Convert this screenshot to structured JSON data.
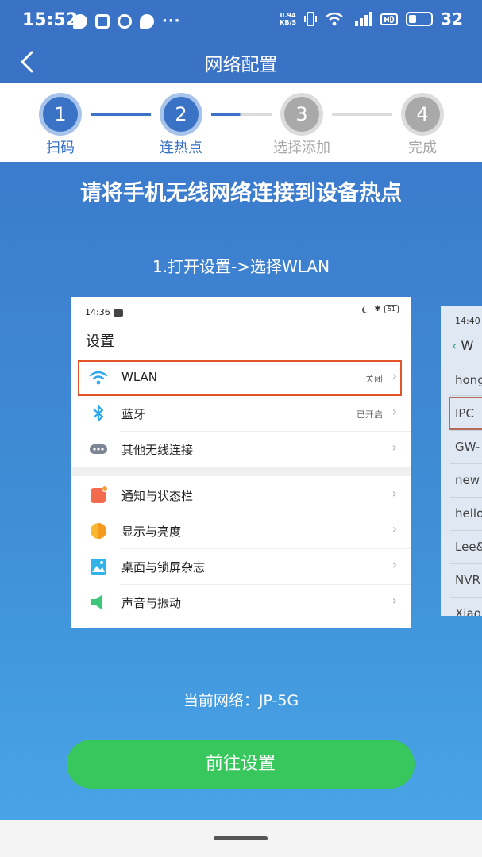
{
  "status_bar": {
    "time": "15:52",
    "net_speed_value": "0.94",
    "net_speed_unit": "KB/S",
    "battery": "32"
  },
  "header": {
    "title": "网络配置"
  },
  "steps": [
    {
      "number": "1",
      "label": "扫码",
      "state": "done"
    },
    {
      "number": "2",
      "label": "连热点",
      "state": "current"
    },
    {
      "number": "3",
      "label": "选择添加",
      "state": "pending"
    },
    {
      "number": "4",
      "label": "完成",
      "state": "pending"
    }
  ],
  "colors": {
    "primary": "#3a73c6",
    "button": "#38c75c",
    "highlight": "#e2552a",
    "inactive": "#a9a9a9"
  },
  "main": {
    "headline": "请将手机无线网络连接到设备热点",
    "instruction": "1.打开设置->选择WLAN",
    "current_network_label": "当前网络：",
    "current_network": "JP-5G",
    "go_settings_button": "前往设置"
  },
  "example_settings": {
    "time": "14:36",
    "battery": "51",
    "title": "设置",
    "items": [
      {
        "label": "WLAN",
        "status": "关闭",
        "icon": "wifi-icon"
      },
      {
        "label": "蓝牙",
        "status": "已开启",
        "icon": "bluetooth-icon"
      },
      {
        "label": "其他无线连接",
        "status": "",
        "icon": "more-connections-icon"
      },
      {
        "label": "通知与状态栏",
        "status": "",
        "icon": "notification-icon"
      },
      {
        "label": "显示与亮度",
        "status": "",
        "icon": "brightness-icon"
      },
      {
        "label": "桌面与锁屏杂志",
        "status": "",
        "icon": "wallpaper-icon"
      },
      {
        "label": "声音与振动",
        "status": "",
        "icon": "sound-icon"
      }
    ]
  },
  "example_wlan": {
    "time": "14:40",
    "title": "W",
    "networks": [
      "hong",
      "IPC",
      "GW-",
      "new",
      "hello",
      "Lee&",
      "NVR",
      "Xiao"
    ]
  }
}
